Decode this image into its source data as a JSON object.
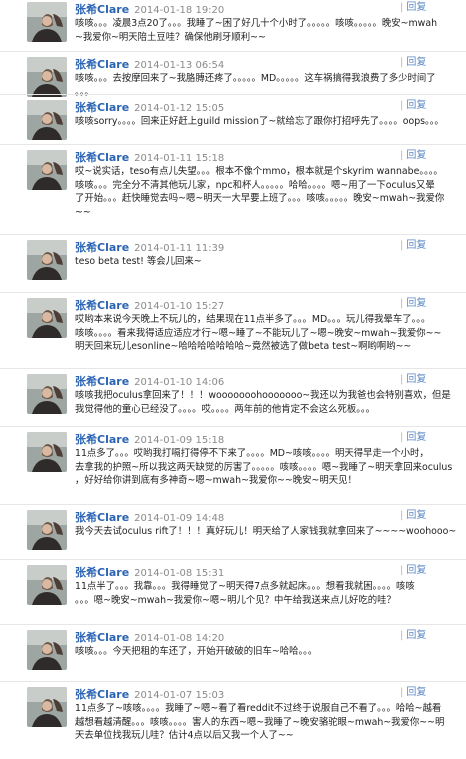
{
  "comments": [
    {
      "author": "张希Clare",
      "time": "2014-01-18 19:20",
      "reply": "回复",
      "lines": [
        "咳咳。。。凌晨3点20了。。。我睡了~困了好几十个小时了。。。。。咳咳。。。。。晚安~mwah",
        "~我爱你~明天陪土豆哇？确保他刷牙顺利~~"
      ]
    },
    {
      "author": "张希Clare",
      "time": "2014-01-13 06:54",
      "reply": "回复",
      "lines": [
        "咳咳。。。去按摩回来了~我胳膊还疼了。。。。。MD。。。。。这车祸搞得我浪费了多少时间了",
        "。。。"
      ]
    },
    {
      "author": "张希Clare",
      "time": "2014-01-12 15:05",
      "reply": "回复",
      "lines": [
        "咳咳sorry。。。。回来正好赶上guild mission了~就给忘了跟你打招呼先了。。。。oops。。。"
      ]
    },
    {
      "author": "张希Clare",
      "time": "2014-01-11 15:18",
      "reply": "回复",
      "lines": [
        "哎~说实话，teso有点儿失望。。。根本不像个mmo，根本就是个skyrim wannabe。。。。",
        "咳咳。。。完全分不清其他玩儿家，npc和杯人。。。。。哈哈。。。。嗯~用了一下oculus又晕",
        "了开始。。。赶快睡觉去吗~嗯~明天一大早要上班了。。。咳咳。。。。。晚安~mwah~我爱你",
        "~~"
      ]
    },
    {
      "author": "张希Clare",
      "time": "2014-01-11 11:39",
      "reply": "回复",
      "lines": [
        "teso beta test! 等会儿回来~"
      ]
    },
    {
      "author": "张希Clare",
      "time": "2014-01-10 15:27",
      "reply": "回复",
      "lines": [
        "哎哟本来说今天晚上不玩儿的，结果现在11点半多了。。。MD。。。玩儿得我晕车了。。。",
        "咳咳。。。。看来我得适应适应才行~嗯~睡了~不能玩儿了~嗯~晚安~mwah~我爱你~~",
        "明天回来玩儿esonline~哈哈哈哈哈哈哈~竟然被选了做beta test~啊哟啊哟~~"
      ]
    },
    {
      "author": "张希Clare",
      "time": "2014-01-10 14:06",
      "reply": "回复",
      "lines": [
        "咳咳我把oculus拿回来了！！！wooooooohooooooo~我还以为我爸也会特别喜欢，但是",
        "我觉得他的童心已经没了。。。。哎。。。。两年前的他肯定不会这么死板。。。"
      ]
    },
    {
      "author": "张希Clare",
      "time": "2014-01-09 15:18",
      "reply": "回复",
      "lines": [
        "11点多了。。。哎哟我打嗝打得停不下来了。。。。MD~咳咳。。。。明天得早走一个小时，",
        "去拿我的护照~所以我这两天缺觉的厉害了。。。。。咳咳。。。。嗯~我睡了~明天拿回来oculus",
        "，好好给你讲到底有多神奇~嗯~mwah~我爱你~~晚安~明天见！"
      ]
    },
    {
      "author": "张希Clare",
      "time": "2014-01-09 14:48",
      "reply": "回复",
      "lines": [
        "我今天去试oculus rift了！！！真好玩儿！明天给了人家钱我就拿回来了~~~~woohooo~"
      ]
    },
    {
      "author": "张希Clare",
      "time": "2014-01-08 15:31",
      "reply": "回复",
      "lines": [
        "11点半了。。。我靠。。。我得睡觉了~明天得7点多就起床。。。想看我就困。。。。咳咳",
        "。。。嗯~晚安~mwah~我爱你~嗯~明儿个见？中午给我送来点儿好吃的哇？"
      ]
    },
    {
      "author": "张希Clare",
      "time": "2014-01-08 14:20",
      "reply": "回复",
      "lines": [
        "咳咳。。。今天把租的车还了，开始开破破的旧车~哈哈。。。"
      ]
    },
    {
      "author": "张希Clare",
      "time": "2014-01-07 15:03",
      "reply": "回复",
      "lines": [
        "11点多了~咳咳。。。。我睡了~嗯~看了看reddit不过终于说服自己不看了。。。哈哈~越看",
        "越想看越清醒。。。咳咳。。。。害人的东西~嗯~我睡了~晚安骆驼眼~mwah~我爱你~~明",
        "天去单位找我玩儿哇？估计4点以后又我一个人了~~"
      ]
    }
  ]
}
